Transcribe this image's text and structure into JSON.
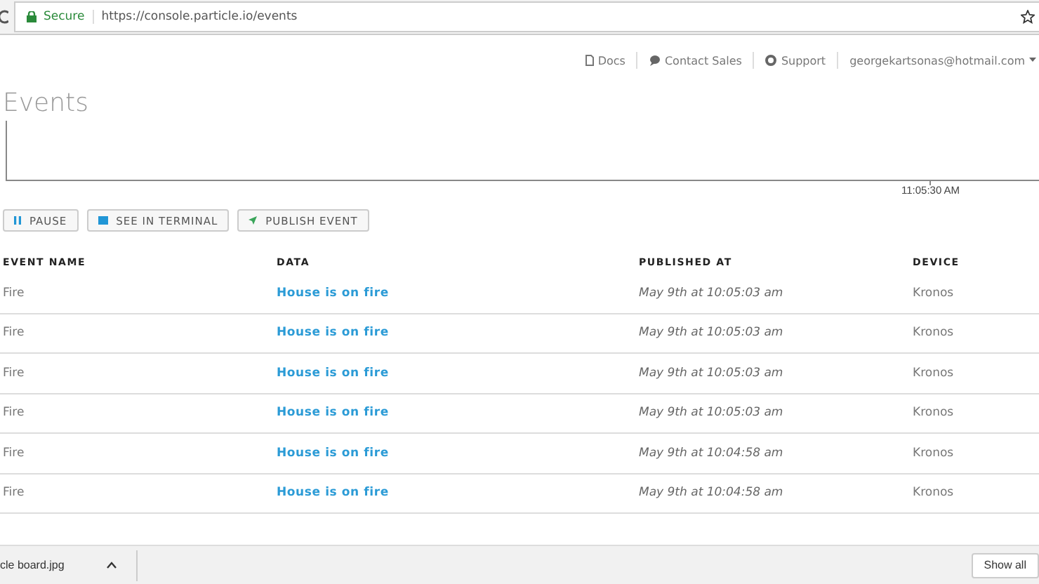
{
  "browser": {
    "secure_label": "Secure",
    "url": "https://console.particle.io/events"
  },
  "top_nav": [
    {
      "kind": "doc",
      "label": "Docs"
    },
    {
      "kind": "chat",
      "label": "Contact Sales"
    },
    {
      "kind": "support",
      "label": "Support"
    },
    {
      "kind": "account",
      "label": "georgekartsonas@hotmail.com"
    }
  ],
  "title": "Events",
  "timeline": {
    "tick_label": "11:05:30 AM"
  },
  "buttons": [
    {
      "kind": "pause",
      "label": "PAUSE"
    },
    {
      "kind": "terminal",
      "label": "SEE IN TERMINAL"
    },
    {
      "kind": "publish",
      "label": "PUBLISH EVENT"
    }
  ],
  "table": {
    "columns": [
      "EVENT NAME",
      "DATA",
      "PUBLISHED AT",
      "DEVICE"
    ],
    "rows": [
      [
        "Fire",
        "House is on fire",
        "May 9th at 10:05:03 am",
        "Kronos"
      ],
      [
        "Fire",
        "House is on fire",
        "May 9th at 10:05:03 am",
        "Kronos"
      ],
      [
        "Fire",
        "House is on fire",
        "May 9th at 10:05:03 am",
        "Kronos"
      ],
      [
        "Fire",
        "House is on fire",
        "May 9th at 10:05:03 am",
        "Kronos"
      ],
      [
        "Fire",
        "House is on fire",
        "May 9th at 10:04:58 am",
        "Kronos"
      ],
      [
        "Fire",
        "House is on fire",
        "May 9th at 10:04:58 am",
        "Kronos"
      ]
    ]
  },
  "download_bar": {
    "file": "cle board.jpg",
    "show_all": "Show all"
  }
}
